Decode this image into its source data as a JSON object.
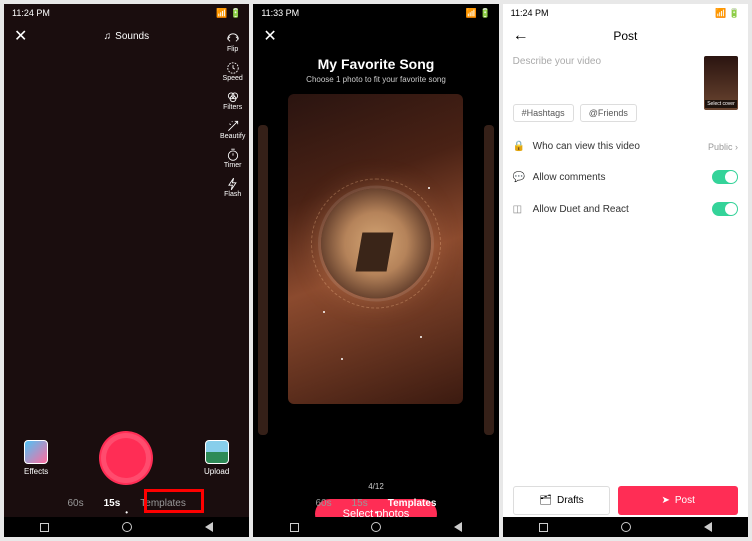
{
  "status": {
    "time1": "11:24 PM",
    "time2": "11:33 PM",
    "time3": "11:24 PM"
  },
  "s1": {
    "sounds": "Sounds",
    "tools": {
      "flip": "Flip",
      "speed": "Speed",
      "filters": "Filters",
      "beautify": "Beautify",
      "timer": "Timer",
      "flash": "Flash"
    },
    "effects": "Effects",
    "upload": "Upload",
    "modes": {
      "m60": "60s",
      "m15": "15s",
      "templates": "Templates"
    }
  },
  "s2": {
    "title": "My Favorite Song",
    "subtitle": "Choose 1 photo to fit your favorite song",
    "page": "4/12",
    "select": "Select photos",
    "modes": {
      "m60": "60s",
      "m15": "15s",
      "templates": "Templates"
    }
  },
  "s3": {
    "title": "Post",
    "desc_placeholder": "Describe your video",
    "thumb": "Select cover",
    "hashtags": "#Hashtags",
    "friends": "@Friends",
    "privacy": "Who can view this video",
    "privacy_val": "Public",
    "comments": "Allow comments",
    "duet": "Allow Duet and React",
    "drafts": "Drafts",
    "post": "Post"
  }
}
